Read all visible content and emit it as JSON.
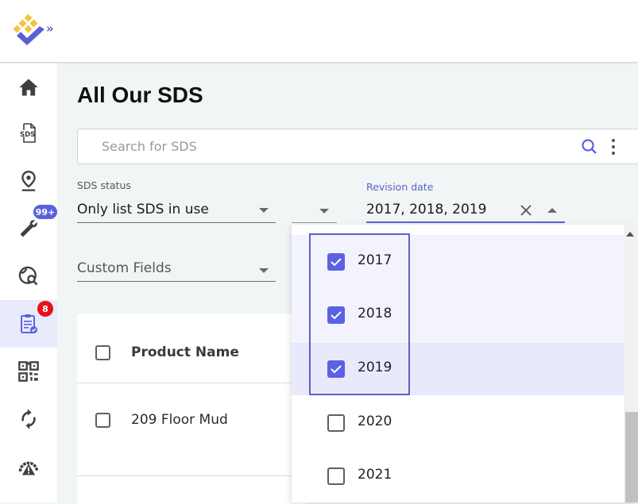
{
  "header": {
    "logo_name": "app-logo",
    "expand_label": "»"
  },
  "sidebar": {
    "items": [
      {
        "id": "home",
        "icon": "home-icon"
      },
      {
        "id": "sds",
        "icon": "sds-document-icon"
      },
      {
        "id": "location",
        "icon": "location-pin-icon"
      },
      {
        "id": "tools",
        "icon": "wrench-icon",
        "badge": "99+"
      },
      {
        "id": "global-search",
        "icon": "globe-search-icon"
      },
      {
        "id": "tasks",
        "icon": "clipboard-check-icon",
        "badge": "8",
        "active": true
      },
      {
        "id": "qr",
        "icon": "qr-code-icon"
      },
      {
        "id": "sync",
        "icon": "sync-icon"
      },
      {
        "id": "risk",
        "icon": "risk-gauge-icon"
      }
    ]
  },
  "page": {
    "title": "All Our SDS"
  },
  "search": {
    "placeholder": "Search for SDS",
    "value": ""
  },
  "filters": {
    "sds_status": {
      "label": "SDS status",
      "value": "Only list SDS in use"
    },
    "hidden_select": {
      "value": ""
    },
    "revision_date": {
      "label": "Revision date",
      "value": "2017, 2018, 2019"
    },
    "custom_fields": {
      "placeholder": "Custom Fields"
    }
  },
  "table": {
    "header": {
      "product_name": "Product Name"
    },
    "rows": [
      {
        "product_name": "209 Floor Mud"
      }
    ]
  },
  "revision_dropdown": {
    "options": [
      {
        "label": "2017",
        "checked": true
      },
      {
        "label": "2018",
        "checked": true
      },
      {
        "label": "2019",
        "checked": true
      },
      {
        "label": "2020",
        "checked": false
      },
      {
        "label": "2021",
        "checked": false
      }
    ]
  },
  "colors": {
    "accent": "#5b61e3",
    "badge_red": "#e3131b",
    "logo_yellow": "#f5c242",
    "logo_purple": "#5a5fd6"
  }
}
